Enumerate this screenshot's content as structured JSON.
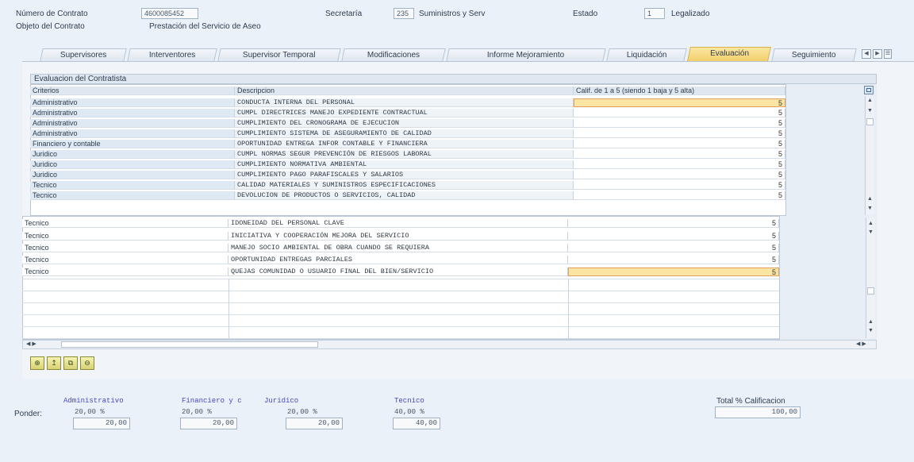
{
  "header": {
    "contract_label": "Número de Contrato",
    "contract_number": "4600085452",
    "object_label": "Objeto del Contrato",
    "object_value": "Prestación del Servicio de Aseo",
    "secretaria_label": "Secretaría",
    "secretaria_code": "235",
    "secretaria_name": "Suministros y Serv",
    "estado_label": "Estado",
    "estado_code": "1",
    "estado_name": "Legalizado"
  },
  "tabs": [
    {
      "label": "Supervisores"
    },
    {
      "label": "Interventores"
    },
    {
      "label": "Supervisor Temporal"
    },
    {
      "label": "Modificaciones"
    },
    {
      "label": "Informe Mejoramiento"
    },
    {
      "label": "Liquidación"
    },
    {
      "label": "Evaluación"
    },
    {
      "label": "Seguimiento"
    }
  ],
  "active_tab": "Evaluación",
  "evaluation": {
    "title": "Evaluacion del Contratista",
    "columns": {
      "criterio": "Criterios",
      "descripcion": "Descripcion",
      "calificacion": "Calif. de 1 a 5 (siendo 1 baja y 5 alta)"
    },
    "rows": [
      {
        "criterio": "Administrativo",
        "descripcion": "CONDUCTA INTERNA DEL PERSONAL",
        "calificacion": "5"
      },
      {
        "criterio": "Administrativo",
        "descripcion": "CUMPL DIRECTRICES MANEJO EXPEDIENTE CONTRACTUAL",
        "calificacion": "5"
      },
      {
        "criterio": "Administrativo",
        "descripcion": "CUMPLIMIENTO DEL CRONOGRAMA DE EJECUCION",
        "calificacion": "5"
      },
      {
        "criterio": "Administrativo",
        "descripcion": "CUMPLIMIENTO SISTEMA DE ASEGURAMIENTO DE CALIDAD",
        "calificacion": "5"
      },
      {
        "criterio": "Financiero y contable",
        "descripcion": "OPORTUNIDAD ENTREGA INFOR CONTABLE Y FINANCIERA",
        "calificacion": "5"
      },
      {
        "criterio": "Juridico",
        "descripcion": "CUMPL NORMAS SEGUR PREVENCIÓN DE RIESGOS LABORAL",
        "calificacion": "5"
      },
      {
        "criterio": "Juridico",
        "descripcion": "CUMPLIMIENTO NORMATIVA AMBIENTAL",
        "calificacion": "5"
      },
      {
        "criterio": "Juridico",
        "descripcion": "CUMPLIMIENTO PAGO PARAFISCALES Y SALARIOS",
        "calificacion": "5"
      },
      {
        "criterio": "Tecnico",
        "descripcion": "CALIDAD MATERIALES Y SUMINISTROS ESPECIFICACIONES",
        "calificacion": "5"
      },
      {
        "criterio": "Tecnico",
        "descripcion": "DEVOLUCION DE PRODUCTOS O SERVICIOS, CALIDAD",
        "calificacion": "5"
      },
      {
        "criterio": "Tecnico",
        "descripcion": "IDONEIDAD DEL PERSONAL CLAVE",
        "calificacion": "5"
      },
      {
        "criterio": "Tecnico",
        "descripcion": "INICIATIVA Y COOPERACIÓN MEJORA DEL SERVICIO",
        "calificacion": "5"
      },
      {
        "criterio": "Tecnico",
        "descripcion": "MANEJO SOCIO AMBIENTAL DE OBRA CUANDO SE REQUIERA",
        "calificacion": "5"
      },
      {
        "criterio": "Tecnico",
        "descripcion": "OPORTUNIDAD ENTREGAS PARCIALES",
        "calificacion": "5"
      },
      {
        "criterio": "Tecnico",
        "descripcion": "QUEJAS COMUNIDAD O USUARIO FINAL DEL BIEN/SERVICIO",
        "calificacion": "5"
      }
    ]
  },
  "ponder": {
    "label": "Ponder:",
    "categories": [
      {
        "name": "Administrativo",
        "pct": "20,00 %",
        "value": "20,00"
      },
      {
        "name": "Financiero y c",
        "pct": "20,00 %",
        "value": "20,00"
      },
      {
        "name": "Juridico",
        "pct": "20,00 %",
        "value": "20,00"
      },
      {
        "name": "Tecnico",
        "pct": "40,00 %",
        "value": "40,00"
      }
    ]
  },
  "total": {
    "label": "Total % Calificacion",
    "value": "100,00"
  }
}
